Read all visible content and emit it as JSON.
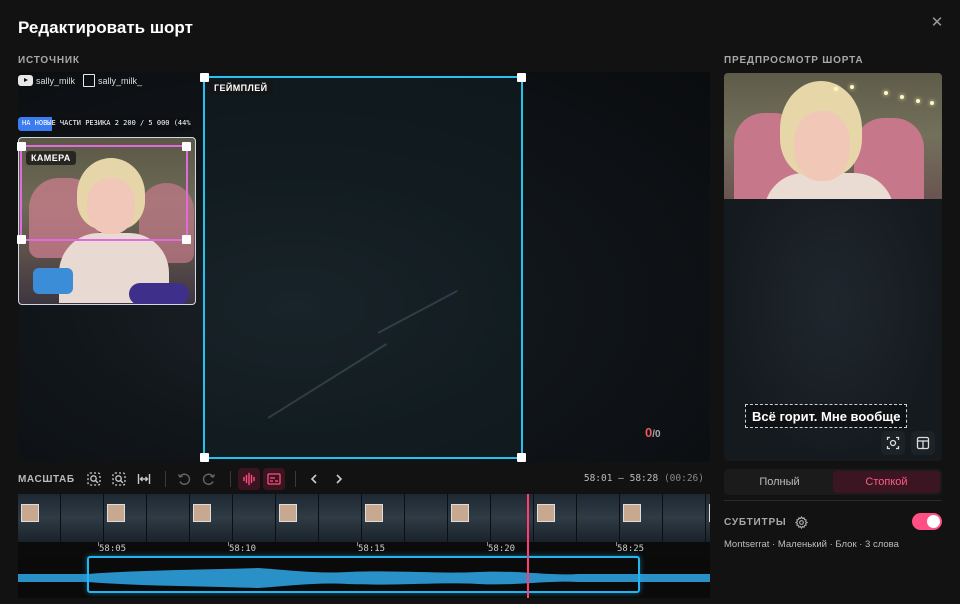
{
  "dialog": {
    "title": "Редактировать шорт",
    "close_icon": "close-icon"
  },
  "source": {
    "label": "ИСТОЧНИК",
    "socials": [
      {
        "icon": "youtube-icon",
        "handle": "sally_milk"
      },
      {
        "icon": "twitch-icon",
        "handle": "sally_milk_"
      }
    ],
    "overlay_progress": {
      "text": "НА НОВЫЕ ЧАСТИ РЕЗИКА 2 200 / 5 000 (44%)",
      "fraction": 0.44
    },
    "camera_label": "КАМЕРА",
    "gameplay_label": "ГЕЙМПЛЕЙ",
    "counter": {
      "current": "0",
      "separator": "/",
      "total": "0"
    }
  },
  "toolbar": {
    "scale_label": "МАСШТАБ",
    "buttons": [
      {
        "icon": "zoom-in-icon"
      },
      {
        "icon": "zoom-out-icon"
      },
      {
        "icon": "fit-width-icon"
      },
      {
        "icon": "undo-icon"
      },
      {
        "icon": "redo-icon"
      },
      {
        "icon": "waveform-icon",
        "active": true
      },
      {
        "icon": "subtitles-track-icon",
        "active": true
      },
      {
        "icon": "chevron-left-icon"
      },
      {
        "icon": "chevron-right-icon"
      }
    ],
    "time_range": "58:01 — 58:28",
    "duration": "(00:26)"
  },
  "timeline": {
    "ticks": [
      "58:05",
      "58:10",
      "58:15",
      "58:20",
      "58:25"
    ],
    "colors": {
      "selection": "#22b5f0",
      "playhead": "#ff3d6e",
      "wave": "#2a90c8"
    }
  },
  "preview": {
    "label": "ПРЕДПРОСМОТР ШОРТА",
    "subtitle_text": "Всё горит. Мне вообще",
    "buttons": [
      {
        "icon": "camera-position-icon"
      },
      {
        "icon": "layout-icon"
      }
    ]
  },
  "layout_mode": {
    "options": [
      "Полный",
      "Стопкой"
    ],
    "selected": "Стопкой"
  },
  "subtitles": {
    "label": "СУБТИТРЫ",
    "settings_icon": "gear-icon",
    "enabled": true,
    "meta": "Montserrat · Маленький · Блок · 3 слова"
  },
  "colors": {
    "accent": "#ff4f85",
    "crop_camera": "#e06ae0",
    "crop_gameplay": "#24c3ef"
  }
}
